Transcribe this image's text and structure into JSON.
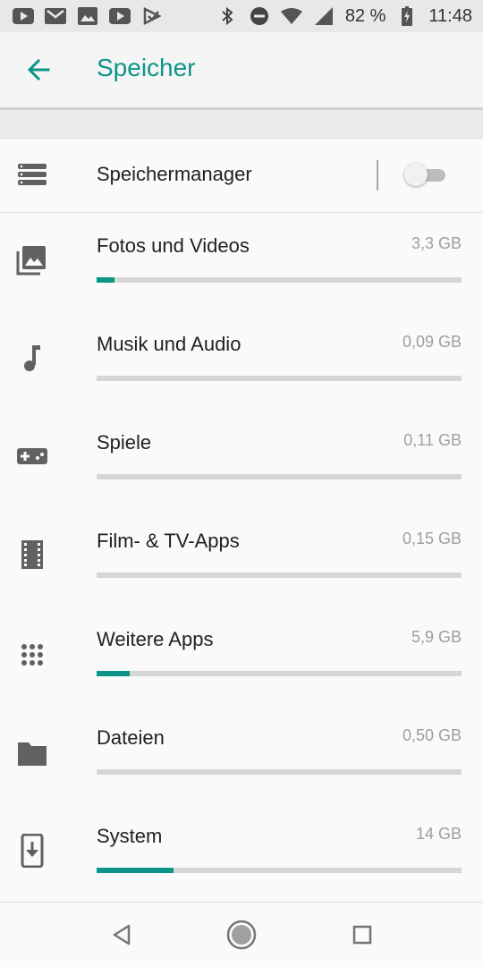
{
  "status_bar": {
    "battery_text": "82 %",
    "time": "11:48",
    "left_icons": [
      "youtube-icon",
      "gmail-icon",
      "photos-icon",
      "youtube-icon",
      "play-store-icon"
    ],
    "right_icons": [
      "bluetooth-icon",
      "do-not-disturb-icon",
      "wifi-icon",
      "signal-icon",
      "battery-charging-icon"
    ]
  },
  "app_bar": {
    "title": "Speicher",
    "back_icon": "arrow-back-icon"
  },
  "storage_manager": {
    "label": "Speichermanager",
    "icon": "storage-manager-icon",
    "toggle_on": false
  },
  "categories": [
    {
      "label": "Fotos und Videos",
      "size": "3,3 GB",
      "icon": "photo-library-icon",
      "fill_fraction": 0.05
    },
    {
      "label": "Musik und Audio",
      "size": "0,09 GB",
      "icon": "music-note-icon",
      "fill_fraction": 0.0
    },
    {
      "label": "Spiele",
      "size": "0,11 GB",
      "icon": "gamepad-icon",
      "fill_fraction": 0.0
    },
    {
      "label": "Film- & TV-Apps",
      "size": "0,15 GB",
      "icon": "movie-film-icon",
      "fill_fraction": 0.0
    },
    {
      "label": "Weitere Apps",
      "size": "5,9 GB",
      "icon": "apps-grid-icon",
      "fill_fraction": 0.09
    },
    {
      "label": "Dateien",
      "size": "0,50 GB",
      "icon": "folder-icon",
      "fill_fraction": 0.0
    },
    {
      "label": "System",
      "size": "14 GB",
      "icon": "system-update-icon",
      "fill_fraction": 0.21
    }
  ],
  "nav_bar": {
    "back": "nav-back-icon",
    "home": "nav-home-icon",
    "recents": "nav-recents-icon"
  },
  "colors": {
    "accent": "#0d9488",
    "track": "#d6d6d6",
    "secondary_text": "#9e9e9e"
  }
}
